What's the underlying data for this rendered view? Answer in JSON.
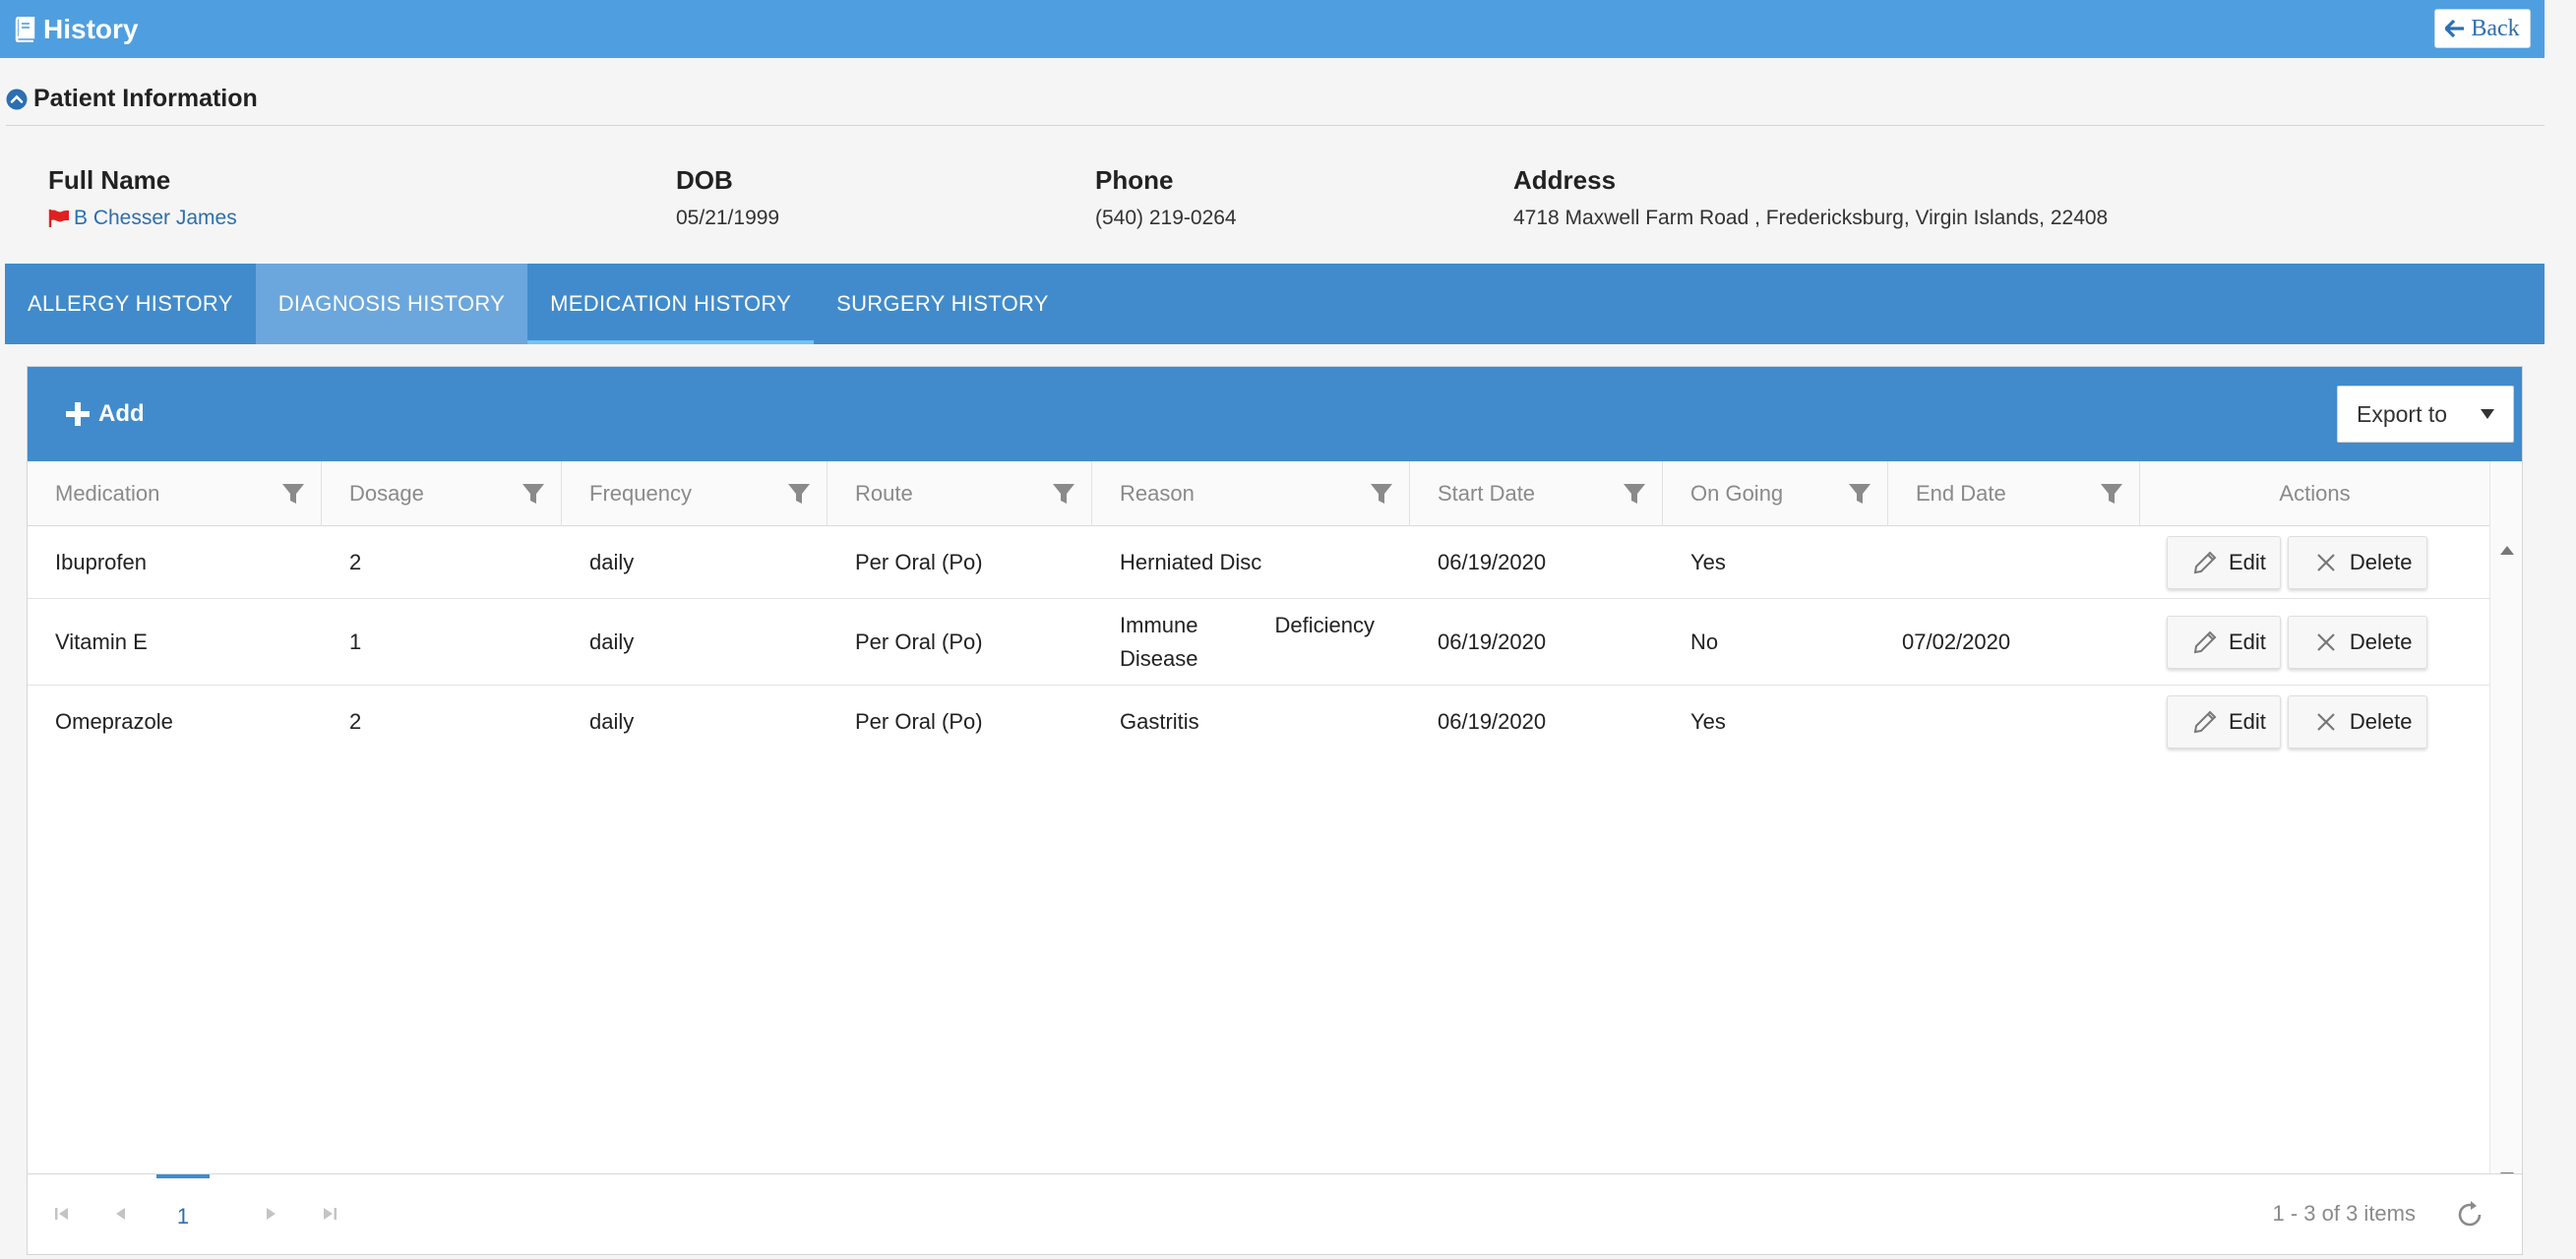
{
  "header": {
    "title": "History",
    "back_label": "Back"
  },
  "patient": {
    "section_title": "Patient Information",
    "labels": {
      "name": "Full Name",
      "dob": "DOB",
      "phone": "Phone",
      "address": "Address"
    },
    "name": "B Chesser James",
    "dob": "05/21/1999",
    "phone": "(540) 219-0264",
    "address": "4718 Maxwell Farm Road , Fredericksburg, Virgin Islands, 22408"
  },
  "tabs": [
    {
      "label": "ALLERGY HISTORY"
    },
    {
      "label": "DIAGNOSIS HISTORY"
    },
    {
      "label": "MEDICATION HISTORY"
    },
    {
      "label": "SURGERY HISTORY"
    }
  ],
  "active_tab": "MEDICATION HISTORY",
  "toolbar": {
    "add_label": "Add",
    "export_label": "Export to"
  },
  "columns": {
    "medication": "Medication",
    "dosage": "Dosage",
    "frequency": "Frequency",
    "route": "Route",
    "reason": "Reason",
    "start_date": "Start Date",
    "on_going": "On Going",
    "end_date": "End Date",
    "actions": "Actions"
  },
  "rows": [
    {
      "medication": "Ibuprofen",
      "dosage": "2",
      "frequency": "daily",
      "route": "Per Oral (Po)",
      "reason": "Herniated Disc",
      "start_date": "06/19/2020",
      "on_going": "Yes",
      "end_date": "",
      "edit": "Edit",
      "delete": "Delete"
    },
    {
      "medication": "Vitamin E",
      "dosage": "1",
      "frequency": "daily",
      "route": "Per Oral (Po)",
      "reason": "Immune Deficiency Disease",
      "start_date": "06/19/2020",
      "on_going": "No",
      "end_date": "07/02/2020",
      "edit": "Edit",
      "delete": "Delete"
    },
    {
      "medication": "Omeprazole",
      "dosage": "2",
      "frequency": "daily",
      "route": "Per Oral (Po)",
      "reason": "Gastritis",
      "start_date": "06/19/2020",
      "on_going": "Yes",
      "end_date": "",
      "edit": "Edit",
      "delete": "Delete"
    }
  ],
  "pager": {
    "current_page": "1",
    "info": "1 - 3 of 3 items"
  },
  "colors": {
    "header_bg": "#4f9fe0",
    "tab_bar_bg": "#418bcc",
    "tab_selected_bg": "#6ba7dc",
    "link": "#2b6fb2",
    "flag": "#e02020"
  }
}
